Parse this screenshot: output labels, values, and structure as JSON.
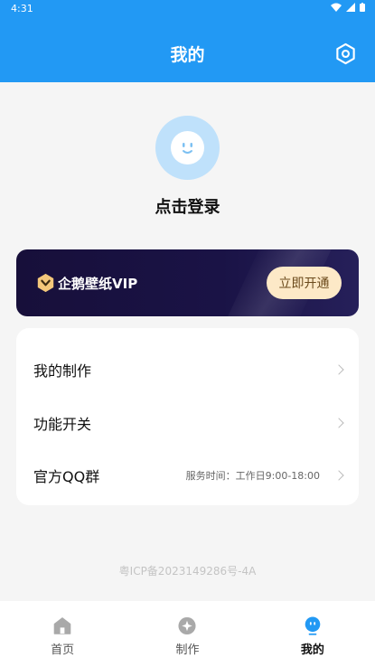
{
  "status_bar": {
    "time": "4:31"
  },
  "header": {
    "title": "我的"
  },
  "profile": {
    "login_text": "点击登录"
  },
  "vip": {
    "label": "企鹅壁纸VIP",
    "button": "立即开通"
  },
  "menu": {
    "items": [
      {
        "label": "我的制作",
        "note": ""
      },
      {
        "label": "功能开关",
        "note": ""
      },
      {
        "label": "官方QQ群",
        "note": "服务时间：工作日9:00-18:00"
      }
    ]
  },
  "footer": {
    "icp": "粤ICP备2023149286号-4A"
  },
  "tabs": [
    {
      "label": "首页",
      "icon": "home-icon",
      "active": false
    },
    {
      "label": "制作",
      "icon": "create-icon",
      "active": false
    },
    {
      "label": "我的",
      "icon": "profile-icon",
      "active": true
    }
  ],
  "colors": {
    "primary": "#2299f4",
    "vip_bg": "#170f3a",
    "vip_button": "#fde9c7"
  }
}
